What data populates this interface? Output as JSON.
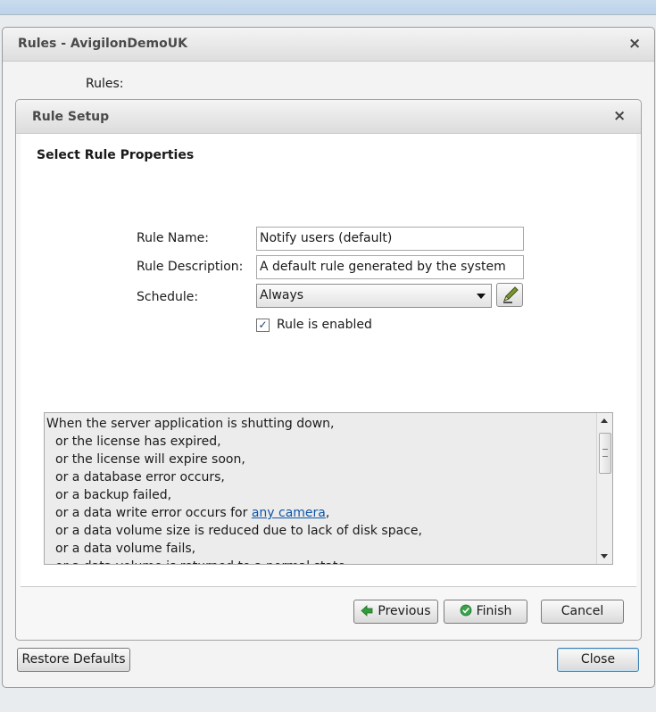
{
  "outer_window": {
    "title": "Rules - AvigilonDemoUK",
    "rules_label": "Rules:",
    "close_glyph": "×",
    "restore_defaults_label": "Restore Defaults",
    "close_label": "Close"
  },
  "rule_setup": {
    "title": "Rule Setup",
    "close_glyph": "×",
    "section_title": "Select Rule Properties",
    "name_label": "Rule Name:",
    "name_value": "Notify users (default)",
    "description_label": "Rule Description:",
    "description_value": "A default rule generated by the system",
    "schedule_label": "Schedule:",
    "schedule_value": "Always",
    "enabled_label": "Rule is enabled",
    "enabled_checked": true,
    "check_glyph": "✓",
    "description_lines": [
      "When the server application is shutting down,",
      "or the license has expired,",
      "or the license will expire soon,",
      "or a database error occurs,",
      "or a backup failed,",
      "or a data write error occurs for ",
      "or a data volume size is reduced due to lack of disk space,",
      "or a data volume fails,",
      "or a data volume is returned to a normal state"
    ],
    "camera_link": "any camera",
    "camera_link_suffix": ",",
    "previous_label": "Previous",
    "finish_label": "Finish",
    "cancel_label": "Cancel"
  },
  "icons": {
    "edit_schedule": "pencil-icon",
    "previous": "arrow-left-icon",
    "finish": "check-circle-icon"
  },
  "colors": {
    "link": "#1155aa",
    "previous_arrow": "#2f9e3a",
    "finish_check": "#3aa34a",
    "focus_border": "#3c7fb1"
  }
}
